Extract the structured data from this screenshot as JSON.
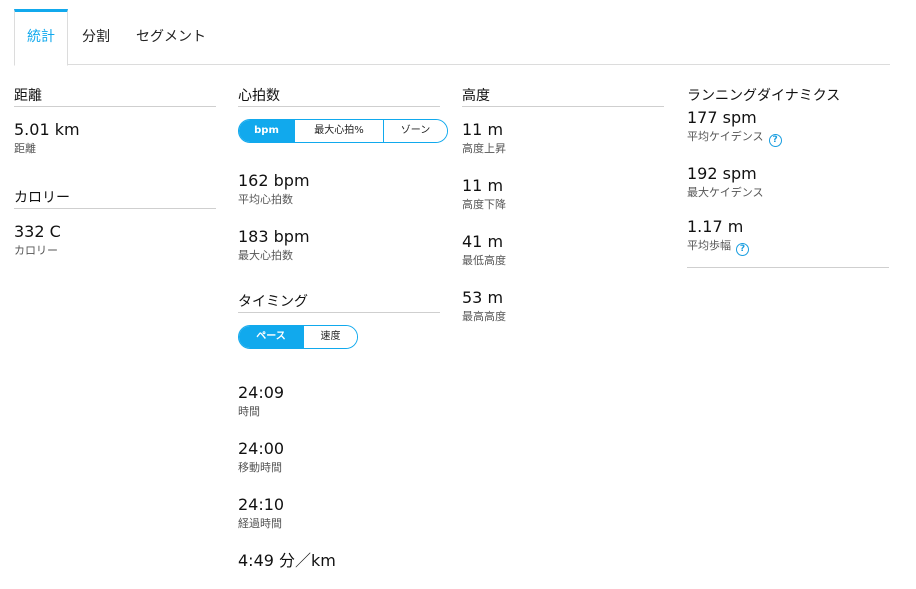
{
  "tabs": [
    {
      "label": "統計"
    },
    {
      "label": "分割"
    },
    {
      "label": "セグメント"
    }
  ],
  "distance": {
    "title": "距離",
    "value": "5.01 km",
    "label": "距離"
  },
  "calories": {
    "title": "カロリー",
    "value": "332 C",
    "label": "カロリー"
  },
  "heart_rate": {
    "title": "心拍数",
    "toggle": [
      "bpm",
      "最大心拍%",
      "ゾーン"
    ],
    "stats": [
      {
        "value": "162 bpm",
        "label": "平均心拍数"
      },
      {
        "value": "183 bpm",
        "label": "最大心拍数"
      }
    ]
  },
  "timing": {
    "title": "タイミング",
    "toggle": [
      "ペース",
      "速度"
    ],
    "stats": [
      {
        "value": "24:09",
        "label": "時間"
      },
      {
        "value": "24:00",
        "label": "移動時間"
      },
      {
        "value": "24:10",
        "label": "経過時間"
      },
      {
        "value": "4:49 分／km",
        "label": ""
      }
    ]
  },
  "elevation": {
    "title": "高度",
    "stats": [
      {
        "value": "11 m",
        "label": "高度上昇"
      },
      {
        "value": "11 m",
        "label": "高度下降"
      },
      {
        "value": "41 m",
        "label": "最低高度"
      },
      {
        "value": "53 m",
        "label": "最高高度"
      }
    ]
  },
  "running_dynamics": {
    "title": "ランニングダイナミクス",
    "help_glyph": "?",
    "stats": [
      {
        "value": "177 spm",
        "label": "平均ケイデンス"
      },
      {
        "value": "192 spm",
        "label": "最大ケイデンス"
      },
      {
        "value": "1.17 m",
        "label": "平均歩幅"
      }
    ]
  },
  "colors": {
    "accent": "#11a9ed",
    "help": "#1a9ee0"
  }
}
